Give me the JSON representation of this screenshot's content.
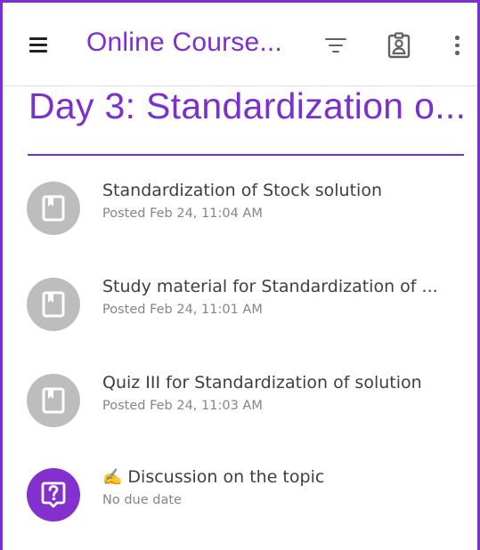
{
  "app_bar": {
    "title": "Online Course...",
    "menu_icon": "hamburger-menu-icon",
    "filter_icon": "filter-icon",
    "classroom_icon": "assignment-ind-icon",
    "more_icon": "more-vert-icon"
  },
  "topic": {
    "title": "Day 3: Standardization o..."
  },
  "items": [
    {
      "title": "Standardization of Stock solution",
      "subtitle": "Posted Feb 24, 11:04 AM",
      "icon": "material-book-icon",
      "icon_color": "#bdbdbd"
    },
    {
      "title": "Study material for Standardization of ...",
      "subtitle": "Posted Feb 24, 11:01 AM",
      "icon": "material-book-icon",
      "icon_color": "#bdbdbd"
    },
    {
      "title": "Quiz III for Standardization of solution",
      "subtitle": "Posted Feb 24, 11:03 AM",
      "icon": "material-book-icon",
      "icon_color": "#bdbdbd"
    },
    {
      "emoji": "✍️",
      "title": "Discussion on the topic",
      "subtitle": "No due date",
      "icon": "question-icon",
      "icon_color": "#8430ce"
    }
  ],
  "colors": {
    "accent": "#7b2fd0",
    "text_primary": "#3c4043",
    "text_secondary": "#80868b",
    "icon_gray": "#bdbdbd",
    "question_purple": "#8430ce"
  }
}
